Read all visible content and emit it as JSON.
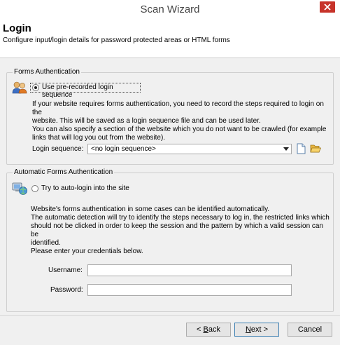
{
  "window": {
    "title": "Scan Wizard"
  },
  "header": {
    "title": "Login",
    "description": "Configure input/login details for password protected areas or HTML forms"
  },
  "forms_auth": {
    "group_label": "Forms Authentication",
    "option_label": "Use pre-recorded login sequence",
    "option_selected": true,
    "para1_line1": "If your website requires forms authentication, you need to record the steps required to login on the",
    "para1_line2": "website. This will be saved as a login sequence file and can be used later.",
    "para1_line3": "You can also specify a section of the website which you do not want to be crawled (for example",
    "para1_line4": "links that will log you out from the website).",
    "sequence_label": "Login sequence:",
    "sequence_value": "<no login sequence>"
  },
  "auto_auth": {
    "group_label": "Automatic Forms Authentication",
    "option_label": "Try to auto-login into the site",
    "option_selected": false,
    "para_line1": "Website's forms authentication in some cases can be identified automatically.",
    "para_line2": "The automatic detection will try to identify the steps necessary to log in, the restricted links which",
    "para_line3": "should not be clicked in order to keep the session and the pattern by which a valid session can be",
    "para_line4": "identified.",
    "credentials_prompt": "Please enter your credentials below.",
    "username_label": "Username:",
    "username_value": "",
    "password_label": "Password:",
    "password_value": ""
  },
  "footer": {
    "back_pre": "< ",
    "back_u": "B",
    "back_post": "ack",
    "next_u": "N",
    "next_post": "ext >",
    "cancel_label": "Cancel"
  }
}
